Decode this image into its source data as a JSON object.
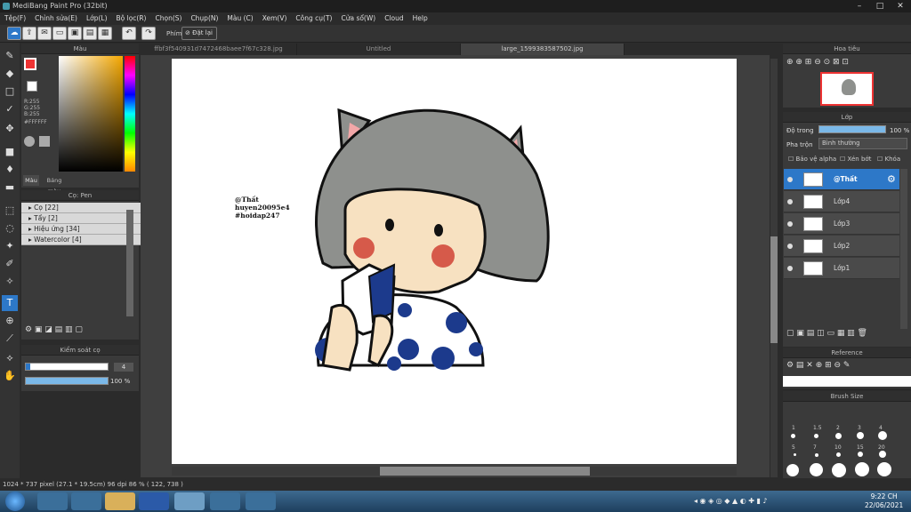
{
  "window": {
    "title": "MediBang Paint Pro (32bit)"
  },
  "menu": [
    "Tệp(F)",
    "Chỉnh sửa(E)",
    "Lớp(L)",
    "Bộ lọc(R)",
    "Chọn(S)",
    "Chụp(N)",
    "Màu (C)",
    "Xem(V)",
    "Công cụ(T)",
    "Cửa sổ(W)",
    "Cloud",
    "Help"
  ],
  "toolbar": {
    "snap_label": "Phím",
    "reset_label": "Đặt lại"
  },
  "tabs": [
    "ffbf3f540931d7472468baee7f67c328.jpg",
    "Untitled",
    "large_1599383587502.jpg"
  ],
  "color_panel": {
    "title": "Màu",
    "rgb": [
      "R:255",
      "G:255",
      "B:255"
    ],
    "hex": "#FFFFFF",
    "tab_color": "Màu",
    "tab_palette": "Bảng màu"
  },
  "brush_panel": {
    "title": "Cọ: Pen",
    "items": [
      "Cọ [22]",
      "Tẩy [2]",
      "Hiệu ứng [34]",
      "Watercolor [4]"
    ]
  },
  "brush_control": {
    "title": "Kiểm soát cọ",
    "size": "4",
    "opacity": "100 %"
  },
  "navigator": {
    "title": "Hoa tiêu"
  },
  "layer_panel": {
    "title": "Lớp",
    "opacity_label": "Độ trong",
    "opacity_value": "100 %",
    "blend_label": "Pha trộn",
    "blend_value": "Bình thường",
    "protect_alpha": "Bảo vệ alpha",
    "clipping": "Xén bớt",
    "lock": "Khóa",
    "layers": [
      "@Thất",
      "Lớp4",
      "Lớp3",
      "Lớp2",
      "Lớp1"
    ]
  },
  "reference_panel": {
    "title": "Reference"
  },
  "brush_size_panel": {
    "title": "Brush Size",
    "labels": [
      "1",
      "1.5",
      "2",
      "3",
      "4",
      "5",
      "7",
      "10",
      "15",
      "20"
    ]
  },
  "canvas_text": {
    "line1": "@Thất",
    "line2": "huyen20095e4",
    "line3": "#hoidap247"
  },
  "status": {
    "text": "1024 * 737 pixel   (27.1 * 19.5cm)   96 dpi   86 %   ( 122, 738 )"
  },
  "taskbar": {
    "time": "9:22 CH",
    "date": "22/06/2021"
  },
  "colors": {
    "accent": "#2d78c8",
    "hair": "#8e908d",
    "skin": "#f7e1c1",
    "cheek": "#d65a4a",
    "dots": "#1c3a8c"
  }
}
